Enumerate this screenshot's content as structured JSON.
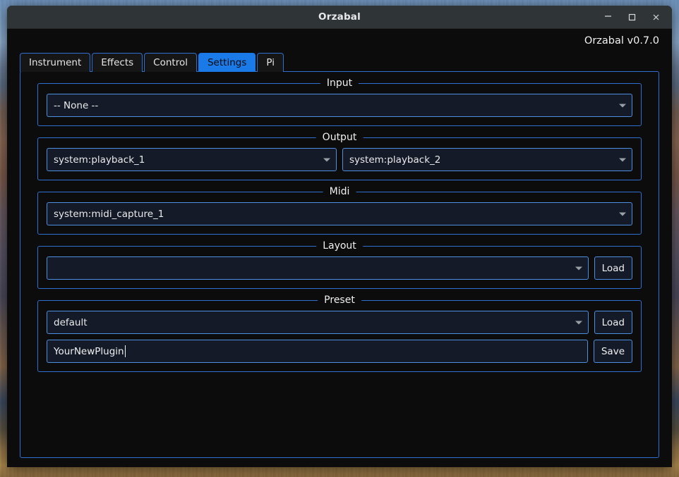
{
  "window": {
    "title": "Orzabal",
    "controls": {
      "minimize_label": "—",
      "maximize_label": "☐",
      "close_label": "✕",
      "minimize_name": "minimize-icon",
      "maximize_name": "maximize-icon",
      "close_name": "close-icon"
    }
  },
  "app": {
    "version_text": "Orzabal v0.7.0"
  },
  "tabs": [
    {
      "label": "Instrument",
      "active": false
    },
    {
      "label": "Effects",
      "active": false
    },
    {
      "label": "Control",
      "active": false
    },
    {
      "label": "Settings",
      "active": true
    },
    {
      "label": "Pi",
      "active": false
    }
  ],
  "groups": {
    "input": {
      "legend": "Input",
      "combo_value": "-- None --",
      "combo_placeholder": "-- None --"
    },
    "output": {
      "legend": "Output",
      "combo_left_value": "system:playback_1",
      "combo_right_value": "system:playback_2"
    },
    "midi": {
      "legend": "Midi",
      "combo_value": "system:midi_capture_1"
    },
    "layout": {
      "legend": "Layout",
      "combo_value": "",
      "load_label": "Load"
    },
    "preset": {
      "legend": "Preset",
      "combo_value": "default",
      "load_label": "Load",
      "name_value": "YourNewPlugin",
      "name_placeholder": "",
      "save_label": "Save"
    }
  },
  "colors": {
    "accent_blue": "#1a7ae8",
    "border_blue": "#2f6fd0",
    "field_border": "#4d8fe0",
    "field_fill": "#141a28",
    "app_bg": "#0c0c0c",
    "titlebar_bg": "#2f3436"
  }
}
